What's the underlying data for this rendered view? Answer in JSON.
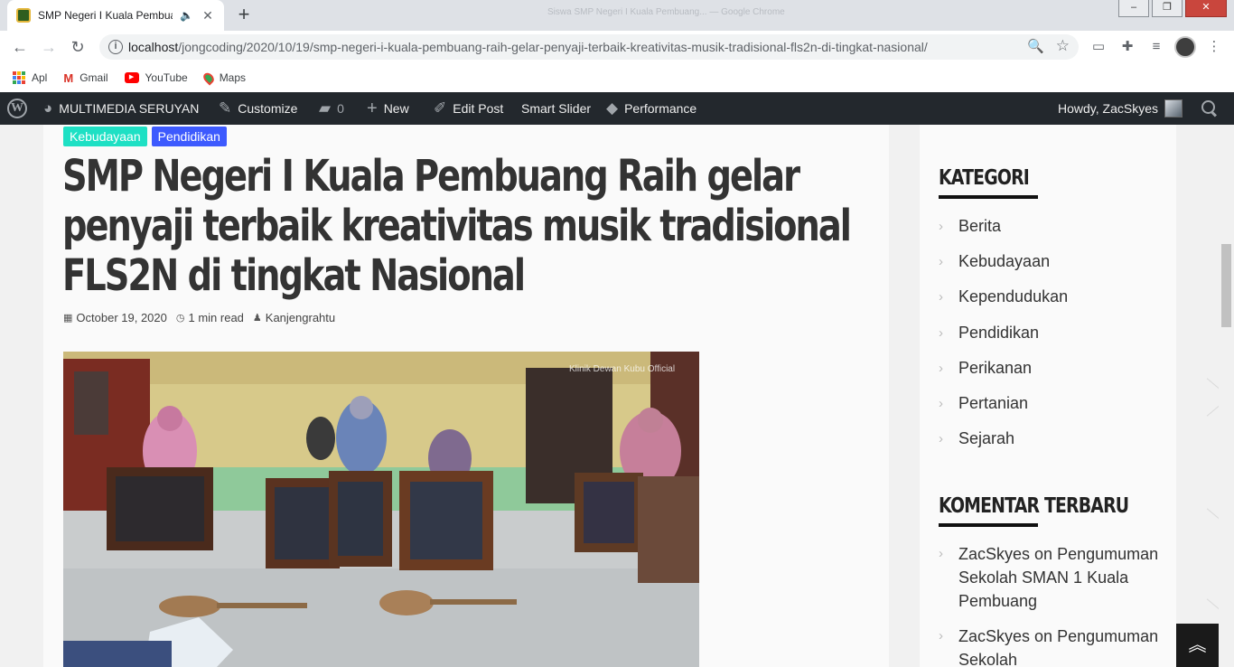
{
  "browser": {
    "tab_title": "SMP Negeri I Kuala Pembuang Raih gelar penyaji terbaik kreativitas musik tradisional FLS2N di tingkat Nasional",
    "window_title": "Siswa SMP Negeri I Kuala Pembuang... — Google Chrome",
    "url_host": "localhost",
    "url_path": "/jongcoding/2020/10/19/smp-negeri-i-kuala-pembuang-raih-gelar-penyaji-terbaik-kreativitas-musik-tradisional-fls2n-di-tingkat-nasional/",
    "bookmarks": [
      {
        "label": "Apl",
        "icon": "apps-grid-icon"
      },
      {
        "label": "Gmail",
        "icon": "gmail-icon"
      },
      {
        "label": "YouTube",
        "icon": "youtube-icon"
      },
      {
        "label": "Maps",
        "icon": "maps-pin-icon"
      }
    ]
  },
  "adminbar": {
    "site_name": "MULTIMEDIA SERUYAN",
    "customize": "Customize",
    "comments_count": "0",
    "new": "New",
    "edit_post": "Edit Post",
    "smart_slider": "Smart Slider",
    "performance": "Performance",
    "howdy": "Howdy, ZacSkyes"
  },
  "article": {
    "categories": [
      {
        "label": "Kebudayaan",
        "color": "#1ee0c4"
      },
      {
        "label": "Pendidikan",
        "color": "#3d5afe"
      }
    ],
    "title": "SMP Negeri I Kuala Pembuang Raih gelar penyaji terbaik kreativitas musik tradisional FLS2N di tingkat Nasional",
    "date": "October 19, 2020",
    "read_time": "1 min read",
    "author": "Kanjengrahtu",
    "image_watermark": "Klinik Dewan Kubu Official"
  },
  "sidebar": {
    "kategori_title": "KATEGORI",
    "categories": [
      "Berita",
      "Kebudayaan",
      "Kependudukan",
      "Pendidikan",
      "Perikanan",
      "Pertanian",
      "Sejarah"
    ],
    "komentar_title": "KOMENTAR TERBARU",
    "comments": [
      {
        "author": "ZacSkyes",
        "on": "on",
        "post": "Pengumuman Sekolah SMAN 1 Kuala Pembuang"
      },
      {
        "author": "ZacSkyes",
        "on": "on",
        "post": "Pengumuman Sekolah"
      }
    ]
  }
}
